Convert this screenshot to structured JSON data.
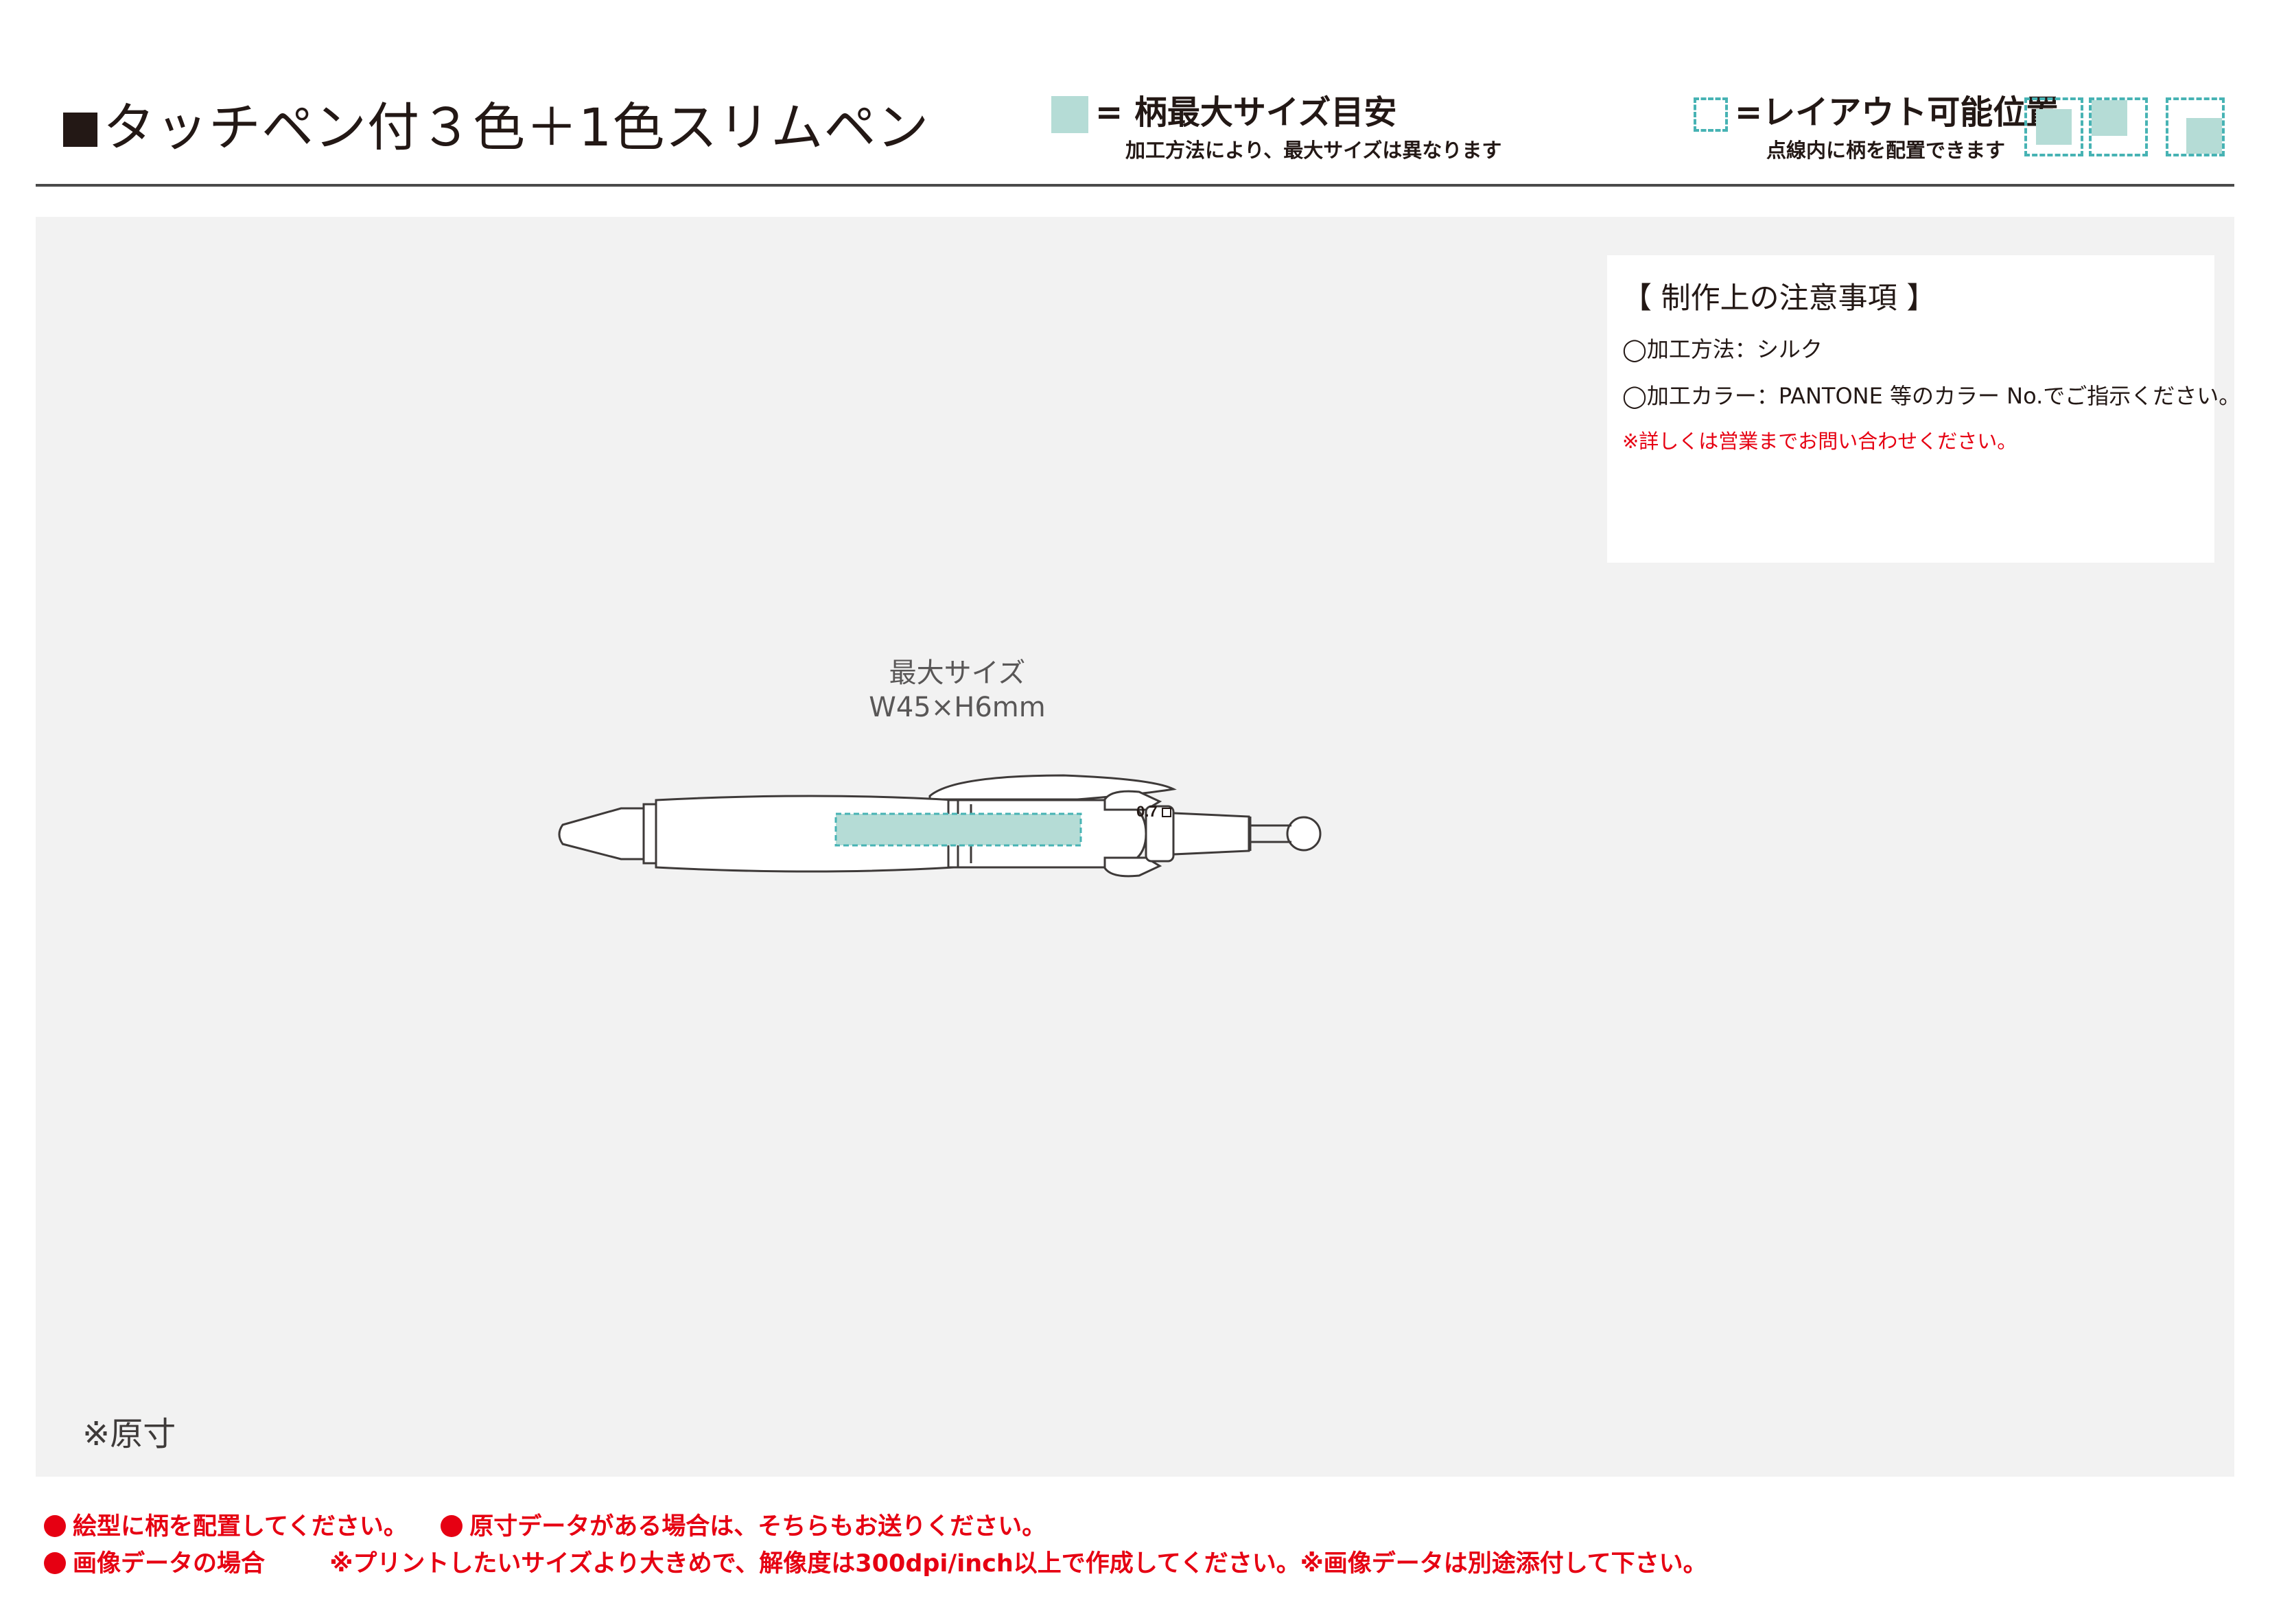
{
  "header": {
    "title": "タッチペン付３色＋1色スリムペン",
    "legend_max_label": "= 柄最大サイズ目安",
    "legend_max_sub": "加工方法により、最大サイズは異なります",
    "legend_layout_label": "=レイアウト可能位置",
    "legend_layout_sub": "点線内に柄を配置できます",
    "colors": {
      "max_area": "#b5dcd6",
      "dash": "#47b3b4",
      "red": "#e60012"
    }
  },
  "notes": {
    "heading": "【 制作上の注意事項 】",
    "method": "◯加工方法：シルク",
    "color": "◯加工カラー：PANTONE 等のカラー No.でご指示ください。",
    "contact": "※詳しくは営業までお問い合わせください。"
  },
  "product": {
    "size_label": "最大サイズ",
    "size_value": "W45×H6mm",
    "pen_mark": "0.7",
    "original_size": "※原寸"
  },
  "footer": {
    "note1": "絵型に柄を配置してください。",
    "note2": "原寸データがある場合は、そちらもお送りください。",
    "note3": "画像データの場合",
    "note4": "※プリントしたいサイズより大きめで、解像度は300dpi/inch以上で作成してください。※画像データは別途添付して下さい。"
  }
}
